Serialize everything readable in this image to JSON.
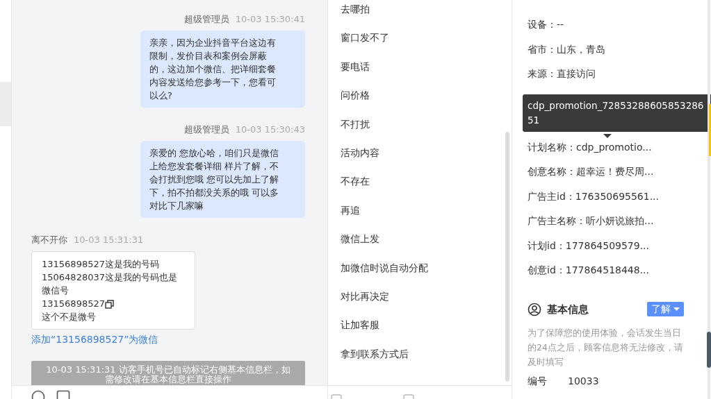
{
  "chat": {
    "messages": [
      {
        "kind": "agent",
        "sender": "超级管理员",
        "time": "10-03 15:30:41",
        "lines": [
          "亲亲，因为企业抖音平台这边有",
          "限制，发价目表和案例会屏蔽",
          "的，这边加个微信、把详细套餐",
          "内容发送给您参考一下，您看可",
          "以么?"
        ]
      },
      {
        "kind": "agent",
        "sender": "超级管理员",
        "time": "10-03 15:30:43",
        "lines": [
          "亲爱的 您放心哈，咱们只是微信",
          "上给您发套餐详细 样片了解，不",
          "会打扰到您哦 您可以先加上了解",
          "下，拍不拍都没关系的哦 可以多",
          "对比下几家嘛"
        ]
      },
      {
        "kind": "visitor",
        "sender": "离不开你",
        "time": "10-03 15:31:31",
        "lines": [
          {
            "text": "13156898527这是我的号码",
            "copy": false
          },
          {
            "text": "15064828037这是我的号码也是",
            "copy": false
          },
          {
            "text": "微信号",
            "copy": false
          },
          {
            "text": "13156898527",
            "copy": true
          },
          {
            "text": "这个不是微号",
            "copy": false
          }
        ],
        "link": "添加“13156898527”为微信"
      },
      {
        "kind": "system",
        "lines": [
          "10-03 15:31:31 访客手机号已自动标记右侧基本信息栏，如",
          "需修改请在基本信息栏直接操作"
        ]
      }
    ]
  },
  "quick_replies": [
    "去哪拍",
    "窗口发不了",
    "要电话",
    "问价格",
    "不打扰",
    "活动内容",
    "不存在",
    "再追",
    "微信上发",
    "加微信时说自动分配",
    "对比再决定",
    "让加客服",
    "拿到联系方式后"
  ],
  "source_info": {
    "fields": [
      {
        "label": "设备：",
        "value": "--"
      },
      {
        "label": "省市：",
        "value": "山东，青岛"
      },
      {
        "label": "来源：",
        "value": "直接访问"
      },
      {
        "label": "计划名称：",
        "value": "cdp_promotio..."
      },
      {
        "label": "创意名称：",
        "value": "超幸运！费尽周..."
      },
      {
        "label": "广告主id：",
        "value": "176350695561..."
      },
      {
        "label": "广告主名称：",
        "value": "听小妍说旅拍..."
      },
      {
        "label": "计划id：",
        "value": "177864509579..."
      },
      {
        "label": "创意id：",
        "value": "177864518448..."
      }
    ],
    "tooltip": {
      "lines": [
        "cdp_promotion_72853288605853286",
        "51"
      ]
    }
  },
  "basic_info": {
    "title": "基本信息",
    "button": "了解",
    "note": "为了保障您的使用体验，会话发生当日的24点之后，顾客信息将无法修改，请及时填写",
    "fields": [
      {
        "label": "编号",
        "value": "10033"
      }
    ]
  }
}
